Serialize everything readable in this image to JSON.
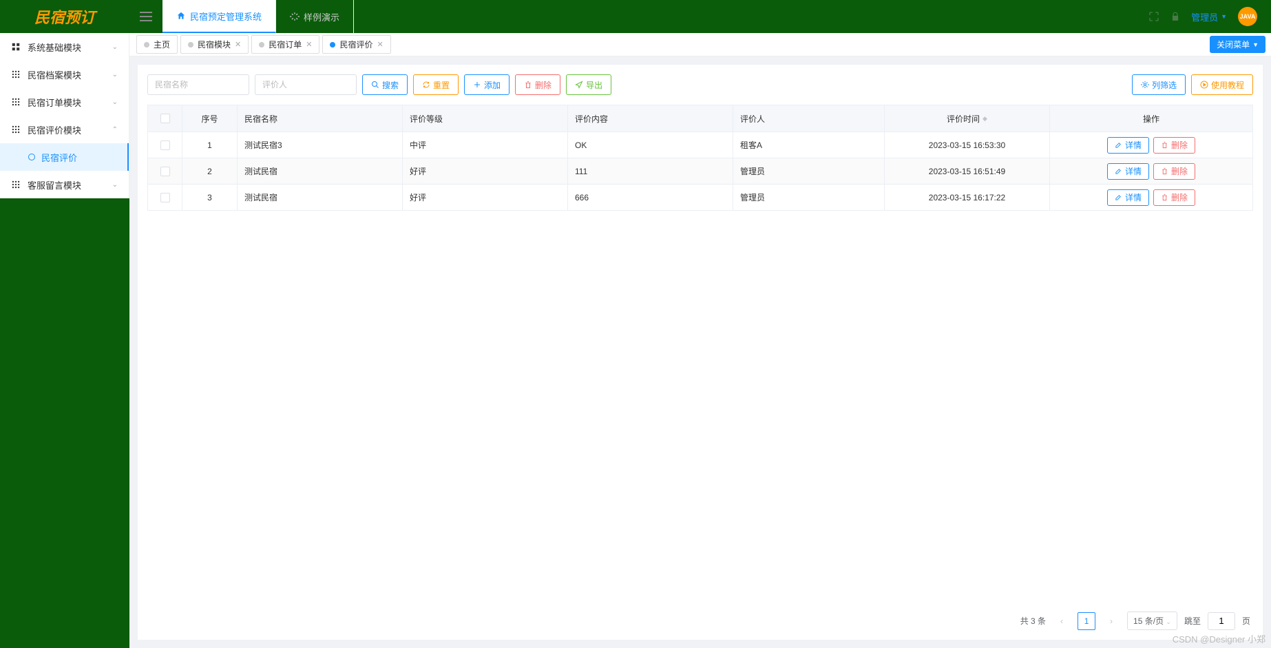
{
  "logo": "民宿预订",
  "header": {
    "tabs": [
      {
        "label": "民宿预定管理系统",
        "active": true
      },
      {
        "label": "样例演示",
        "active": false
      }
    ],
    "user": "管理员",
    "avatar": "JAVA"
  },
  "sidebar": {
    "items": [
      {
        "label": "系统基础模块",
        "expanded": false
      },
      {
        "label": "民宿档案模块",
        "expanded": false
      },
      {
        "label": "民宿订单模块",
        "expanded": false
      },
      {
        "label": "民宿评价模块",
        "expanded": true
      },
      {
        "label": "客服留言模块",
        "expanded": false
      }
    ],
    "submenu_label": "民宿评价"
  },
  "tabs": {
    "items": [
      {
        "label": "主页",
        "closable": false,
        "active": false
      },
      {
        "label": "民宿模块",
        "closable": true,
        "active": false
      },
      {
        "label": "民宿订单",
        "closable": true,
        "active": false
      },
      {
        "label": "民宿评价",
        "closable": true,
        "active": true
      }
    ],
    "close_menu": "关闭菜单"
  },
  "toolbar": {
    "placeholder_name": "民宿名称",
    "placeholder_person": "评价人",
    "search": "搜索",
    "reset": "重置",
    "add": "添加",
    "delete": "删除",
    "export": "导出",
    "filter": "列筛选",
    "tutorial": "使用教程"
  },
  "table": {
    "headers": {
      "num": "序号",
      "name": "民宿名称",
      "level": "评价等级",
      "content": "评价内容",
      "person": "评价人",
      "time": "评价时间",
      "action": "操作"
    },
    "rows": [
      {
        "num": "1",
        "name": "测试民宿3",
        "level": "中评",
        "content": "OK",
        "person": "租客A",
        "time": "2023-03-15 16:53:30"
      },
      {
        "num": "2",
        "name": "测试民宿",
        "level": "好评",
        "content": "111",
        "person": "管理员",
        "time": "2023-03-15 16:51:49"
      },
      {
        "num": "3",
        "name": "测试民宿",
        "level": "好评",
        "content": "666",
        "person": "管理员",
        "time": "2023-03-15 16:17:22"
      }
    ],
    "action_detail": "详情",
    "action_delete": "删除"
  },
  "pagination": {
    "total_label": "共 3 条",
    "current": "1",
    "page_size": "15 条/页",
    "jump_label": "跳至",
    "jump_value": "1",
    "page_suffix": "页"
  },
  "watermark": "CSDN @Designer 小郑"
}
